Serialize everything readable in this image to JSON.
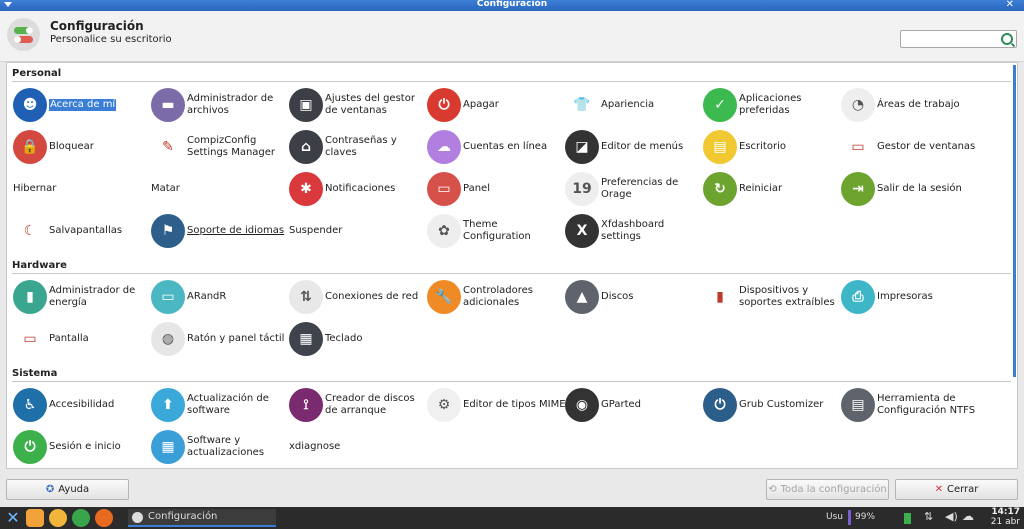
{
  "window": {
    "title": "Configuración"
  },
  "header": {
    "title": "Configuración",
    "subtitle": "Personalice su escritorio",
    "search_placeholder": ""
  },
  "sections": {
    "personal": "Personal",
    "hardware": "Hardware",
    "sistema": "Sistema"
  },
  "items": [
    {
      "label": "Acerca de mí",
      "icon": "user-icon",
      "color": "#1f5fb4",
      "selected": true
    },
    {
      "label": "Administrador de archivos",
      "icon": "folder-icon",
      "color": "#7b6ba8"
    },
    {
      "label": "Ajustes del gestor de ventanas",
      "icon": "window-settings-icon",
      "color": "#3c3f46"
    },
    {
      "label": "Apagar",
      "icon": "power-icon",
      "color": "#d93a2f"
    },
    {
      "label": "Apariencia",
      "icon": "tshirt-icon",
      "color": "#ffffff"
    },
    {
      "label": "Aplicaciones preferidas",
      "icon": "checkmark-icon",
      "color": "#3cb94f"
    },
    {
      "label": "Áreas de trabajo",
      "icon": "workspaces-icon",
      "color": "#eeeeee"
    },
    {
      "label": "Bloquear",
      "icon": "lock-icon",
      "color": "#d4493f"
    },
    {
      "label": "CompizConfig Settings Manager",
      "icon": "compiz-icon",
      "color": "#ffffff"
    },
    {
      "label": "Contraseñas y claves",
      "icon": "keyring-icon",
      "color": "#3c3f46"
    },
    {
      "label": "Cuentas en línea",
      "icon": "cloud-icon",
      "color": "#b07fe0"
    },
    {
      "label": "Editor de menús",
      "icon": "menu-editor-icon",
      "color": "#333333"
    },
    {
      "label": "Escritorio",
      "icon": "desktop-icon",
      "color": "#f0c832"
    },
    {
      "label": "Gestor de ventanas",
      "icon": "window-manager-icon",
      "color": "#ffffff"
    },
    {
      "label": "Hibernar",
      "icon": "",
      "color": ""
    },
    {
      "label": "Matar",
      "icon": "",
      "color": ""
    },
    {
      "label": "Notificaciones",
      "icon": "notification-icon",
      "color": "#d9393d"
    },
    {
      "label": "Panel",
      "icon": "panel-icon",
      "color": "#d5514a"
    },
    {
      "label": "Preferencias de Orage",
      "icon": "calendar-icon",
      "color": "#eeeeee"
    },
    {
      "label": "Reiniciar",
      "icon": "restart-icon",
      "color": "#6da42f"
    },
    {
      "label": "Salir de la sesión",
      "icon": "logout-icon",
      "color": "#6da42f"
    },
    {
      "label": "Salvapantallas",
      "icon": "screensaver-icon",
      "color": "#ffffff"
    },
    {
      "label": "Soporte de idiomas",
      "icon": "language-icon",
      "color": "#2d5f8a",
      "underline": true
    },
    {
      "label": "Suspender",
      "icon": "",
      "color": ""
    },
    {
      "label": "Theme Configuration",
      "icon": "theme-icon",
      "color": "#eeeeee"
    },
    {
      "label": "Xfdashboard settings",
      "icon": "xfdashboard-icon",
      "color": "#333333"
    },
    {
      "label": "Administrador de energía",
      "icon": "battery-icon",
      "color": "#3aa68f"
    },
    {
      "label": "ARandR",
      "icon": "monitor-icon",
      "color": "#4ab7c2"
    },
    {
      "label": "Conexiones de red",
      "icon": "network-icon",
      "color": "#e8e8e8"
    },
    {
      "label": "Controladores adicionales",
      "icon": "wrench-icon",
      "color": "#f08a24"
    },
    {
      "label": "Discos",
      "icon": "disk-icon",
      "color": "#5f646c"
    },
    {
      "label": "Dispositivos y soportes extraíbles",
      "icon": "usb-icon",
      "color": "#ffffff"
    },
    {
      "label": "Impresoras",
      "icon": "printer-icon",
      "color": "#3db7c8"
    },
    {
      "label": "Pantalla",
      "icon": "display-icon",
      "color": "#ffffff"
    },
    {
      "label": "Ratón y panel táctil",
      "icon": "mouse-icon",
      "color": "#e6e6e6"
    },
    {
      "label": "Teclado",
      "icon": "keyboard-icon",
      "color": "#3f434c"
    },
    {
      "label": "Accesibilidad",
      "icon": "accessibility-icon",
      "color": "#1f6fa8"
    },
    {
      "label": "Actualización de software",
      "icon": "software-update-icon",
      "color": "#3aa9d9"
    },
    {
      "label": "Creador de discos de arranque",
      "icon": "usb-creator-icon",
      "color": "#7a2a6e"
    },
    {
      "label": "Editor de tipos MIME",
      "icon": "gear-icon",
      "color": "#f0f0f0"
    },
    {
      "label": "GParted",
      "icon": "gparted-icon",
      "color": "#333333"
    },
    {
      "label": "Grub Customizer",
      "icon": "grub-icon",
      "color": "#2b5f8a"
    },
    {
      "label": "Herramienta de Configuración NTFS",
      "icon": "ntfs-icon",
      "color": "#5f646c"
    },
    {
      "label": "Sesión e inicio",
      "icon": "power-session-icon",
      "color": "#3cb04a"
    },
    {
      "label": "Software y actualizaciones",
      "icon": "package-icon",
      "color": "#3a9fd6"
    },
    {
      "label": "xdiagnose",
      "icon": "",
      "color": ""
    }
  ],
  "buttons": {
    "help": "Ayuda",
    "all_settings": "Toda la configuración",
    "close": "Cerrar"
  },
  "taskbar": {
    "window_label": "Configuración",
    "keyboard_layout": "Usu",
    "battery": "99%",
    "time": "14:17",
    "date": "21 abr"
  }
}
